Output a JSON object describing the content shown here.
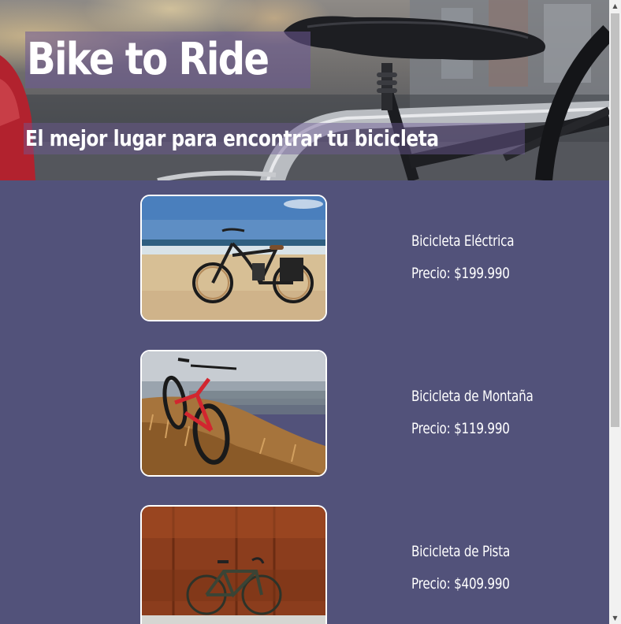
{
  "hero": {
    "title": "Bike to Ride",
    "subtitle": "El mejor lugar para encontrar tu bicicleta",
    "image": "bicycle-saddle-photo"
  },
  "products": [
    {
      "name": "Bicicleta Eléctrica",
      "price": "Precio: $199.990",
      "image": "electric-bike-on-beach-photo"
    },
    {
      "name": "Bicicleta de Montaña",
      "price": "Precio: $119.990",
      "image": "mountain-bike-on-hill-photo"
    },
    {
      "name": "Bicicleta de Pista",
      "price": "Precio: $409.990",
      "image": "track-bike-against-wall-photo"
    }
  ],
  "scrollbar": {
    "up_icon": "scroll-up-arrow-icon",
    "down_icon": "scroll-down-arrow-icon"
  },
  "colors": {
    "page_background": "#52527a",
    "text": "#ffffff",
    "photo_border": "#ffffff"
  }
}
